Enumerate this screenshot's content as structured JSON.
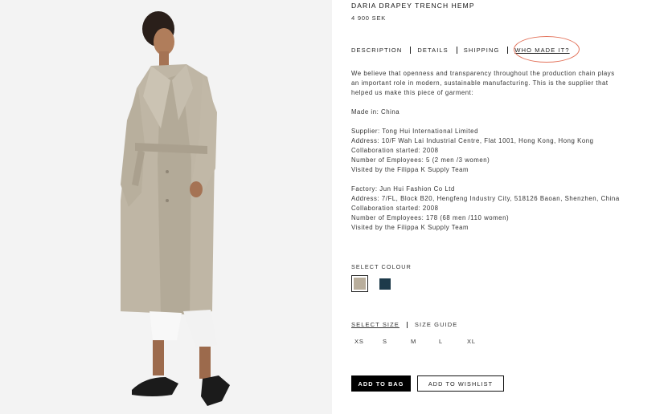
{
  "product": {
    "name": "DARIA DRAPEY TRENCH HEMP",
    "price": "4 900 SEK"
  },
  "tabs": [
    {
      "label": "DESCRIPTION",
      "active": false
    },
    {
      "label": "DETAILS",
      "active": false
    },
    {
      "label": "SHIPPING",
      "active": false
    },
    {
      "label": "WHO MADE IT?",
      "active": true
    }
  ],
  "content": {
    "intro": [
      "We believe that openness and transparency throughout the production chain plays",
      "an important role in modern, sustainable manufacturing. This is the supplier that",
      "helped us make this piece of garment:"
    ],
    "made_in": "Made in: China",
    "supplier": [
      "Supplier: Tong Hui International Limited",
      "Address: 10/F Wah Lai Industrial Centre, Flat 1001, Hong Kong, Hong Kong",
      "Collaboration started: 2008",
      "Number of Employees: 5 (2 men /3 women)",
      "Visited by the Filippa K Supply Team"
    ],
    "factory": [
      "Factory: Jun Hui Fashion Co Ltd",
      "Address: 7/FL, Block B20, Hengfeng Industry City, 518126 Baoan, Shenzhen, China",
      "Collaboration started: 2008",
      "Number of Employees: 178 (68 men /110 women)",
      "Visited by the Filippa K Supply Team"
    ]
  },
  "colour": {
    "label": "SELECT COLOUR",
    "options": [
      {
        "name": "beige-swatch",
        "hex": "#b9ae9c",
        "selected": true
      },
      {
        "name": "navy-swatch",
        "hex": "#1d3a4a",
        "selected": false
      }
    ]
  },
  "size": {
    "select_label": "SELECT SIZE",
    "guide_label": "SIZE GUIDE",
    "options": [
      "XS",
      "S",
      "M",
      "L",
      "XL"
    ]
  },
  "buttons": {
    "add_to_bag": "ADD TO BAG",
    "add_to_wishlist": "ADD TO WISHLIST"
  },
  "colors": {
    "highlight_circle": "#e3735b",
    "photo_background": "#f3f3f3"
  }
}
